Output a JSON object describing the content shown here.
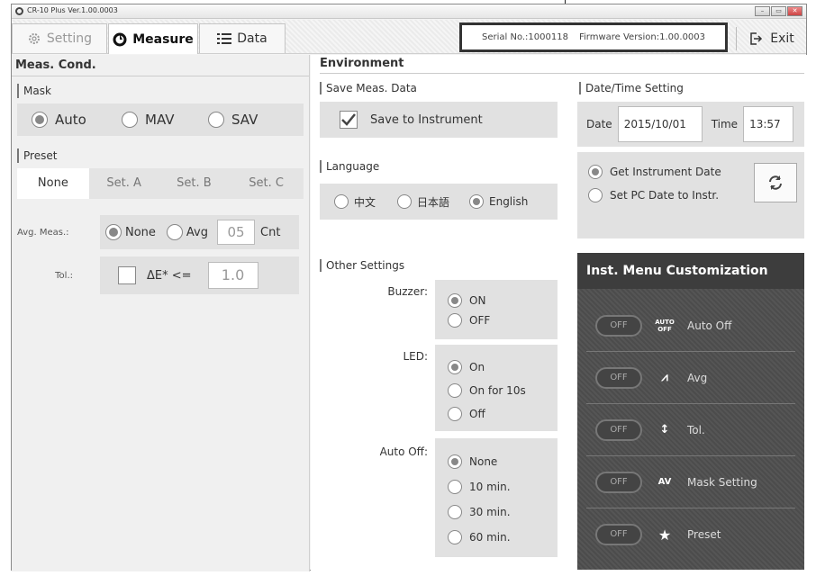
{
  "window": {
    "title": "CR-10 Plus Ver.1.00.0003"
  },
  "tabs": [
    {
      "label": "Setting",
      "icon": "gear-icon"
    },
    {
      "label": "Measure",
      "icon": "measure-icon"
    },
    {
      "label": "Data",
      "icon": "list-icon"
    }
  ],
  "device": {
    "serial": "Serial No.:1000118",
    "firmware": "Firmware Version:1.00.0003"
  },
  "exit_label": "Exit",
  "meas_cond": {
    "title": "Meas. Cond.",
    "mask": {
      "label": "Mask",
      "options": [
        "Auto",
        "MAV",
        "SAV"
      ],
      "selected": "Auto"
    },
    "preset": {
      "label": "Preset",
      "tabs": [
        "None",
        "Set. A",
        "Set. B",
        "Set. C"
      ],
      "active": "None"
    },
    "avg": {
      "label": "Avg. Meas.:",
      "options": [
        "None",
        "Avg"
      ],
      "selected": "None",
      "count": "05",
      "unit": "Cnt"
    },
    "tol": {
      "label": "Tol.:",
      "expr": "ΔE* <=",
      "value": "1.0"
    }
  },
  "environment": {
    "title": "Environment",
    "save": {
      "label": "Save Meas. Data",
      "checkbox_label": "Save to Instrument",
      "checked": true
    },
    "language": {
      "label": "Language",
      "options": [
        "中文",
        "日本語",
        "English"
      ],
      "selected": "English"
    },
    "other": {
      "label": "Other Settings",
      "buzzer": {
        "label": "Buzzer:",
        "options": [
          "ON",
          "OFF"
        ],
        "selected": "ON"
      },
      "led": {
        "label": "LED:",
        "options": [
          "On",
          "On for 10s",
          "Off"
        ],
        "selected": "On"
      },
      "autooff": {
        "label": "Auto Off:",
        "options": [
          "None",
          "10 min.",
          "30 min.",
          "60 min."
        ],
        "selected": "None"
      }
    },
    "datetime": {
      "label": "Date/Time Setting",
      "date_label": "Date",
      "date": "2015/10/01",
      "time_label": "Time",
      "time": "13:57",
      "options": [
        "Get Instrument Date",
        "Set PC Date to Instr."
      ],
      "selected": "Get Instrument Date"
    },
    "customization": {
      "title": "Inst. Menu Customization",
      "items": [
        {
          "state": "OFF",
          "icon": "auto-off-icon",
          "glyph": "AUTO OFF",
          "label": "Auto Off"
        },
        {
          "state": "OFF",
          "icon": "avg-icon",
          "glyph": "⩘",
          "label": "Avg"
        },
        {
          "state": "OFF",
          "icon": "tolerance-icon",
          "glyph": "↕",
          "label": "Tol."
        },
        {
          "state": "OFF",
          "icon": "mask-icon",
          "glyph": "AV",
          "label": "Mask Setting"
        },
        {
          "state": "OFF",
          "icon": "star-icon",
          "glyph": "★",
          "label": "Preset"
        }
      ]
    }
  }
}
